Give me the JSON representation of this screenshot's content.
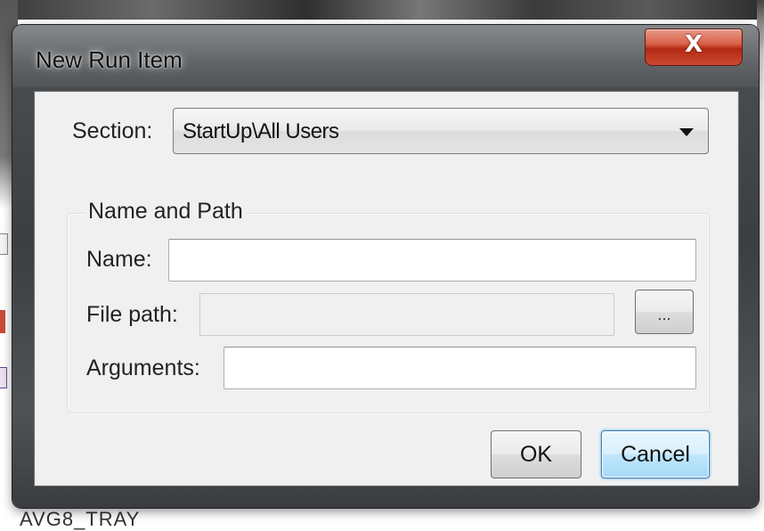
{
  "dialog": {
    "title": "New Run Item",
    "close_symbol": "X"
  },
  "section": {
    "label": "Section:",
    "selected": "StartUp\\All Users"
  },
  "name_and_path": {
    "group_title": "Name and Path",
    "name_label": "Name:",
    "name_value": "",
    "file_path_label": "File path:",
    "file_path_value": "",
    "browse_label": "...",
    "arguments_label": "Arguments:",
    "arguments_value": ""
  },
  "buttons": {
    "ok": "OK",
    "cancel": "Cancel"
  },
  "background": {
    "partial_text": "AVG8_TRAY"
  },
  "icons": {
    "close": "close-icon",
    "dropdown_arrow": "chevron-down-icon"
  },
  "colors": {
    "close_button": "#c9402a",
    "client_bg": "#f0f0f0",
    "cancel_focus": "#3c7fb1"
  }
}
